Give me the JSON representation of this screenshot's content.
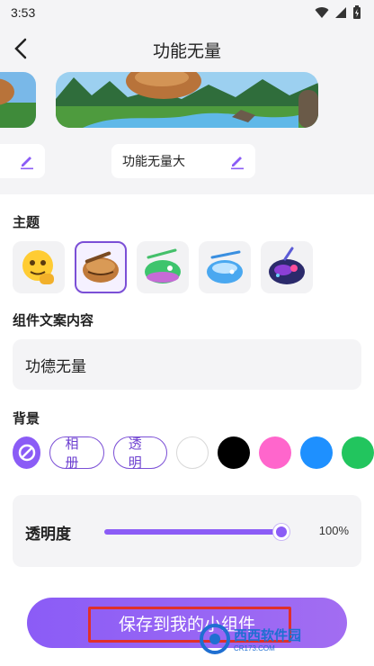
{
  "status_bar": {
    "time": "3:53"
  },
  "header": {
    "title": "功能无量"
  },
  "preview": {
    "chip_text": "功能无量大"
  },
  "sections": {
    "theme_label": "主题",
    "text_label": "组件文案内容",
    "background_label": "背景"
  },
  "themes": [
    {
      "icon": "thumbs-up-emoji-icon",
      "selected": false
    },
    {
      "icon": "wooden-fish-icon",
      "selected": true
    },
    {
      "icon": "green-wooden-fish-icon",
      "selected": false
    },
    {
      "icon": "blue-wooden-fish-icon",
      "selected": false
    },
    {
      "icon": "galaxy-wooden-fish-icon",
      "selected": false
    }
  ],
  "text_input": {
    "value": "功德无量"
  },
  "background": {
    "options": [
      "相册",
      "透明"
    ],
    "swatches": [
      "#ffffff",
      "#000000",
      "#ff66cc",
      "#1e90ff",
      "#22c55e"
    ],
    "accent": "#8b5cf6"
  },
  "opacity": {
    "label": "透明度",
    "value_text": "100%",
    "level": 1.0
  },
  "save_button": {
    "label": "保存到我的小组件"
  },
  "watermark": {
    "text": "西西软件园",
    "sub": "CR173.COM"
  }
}
